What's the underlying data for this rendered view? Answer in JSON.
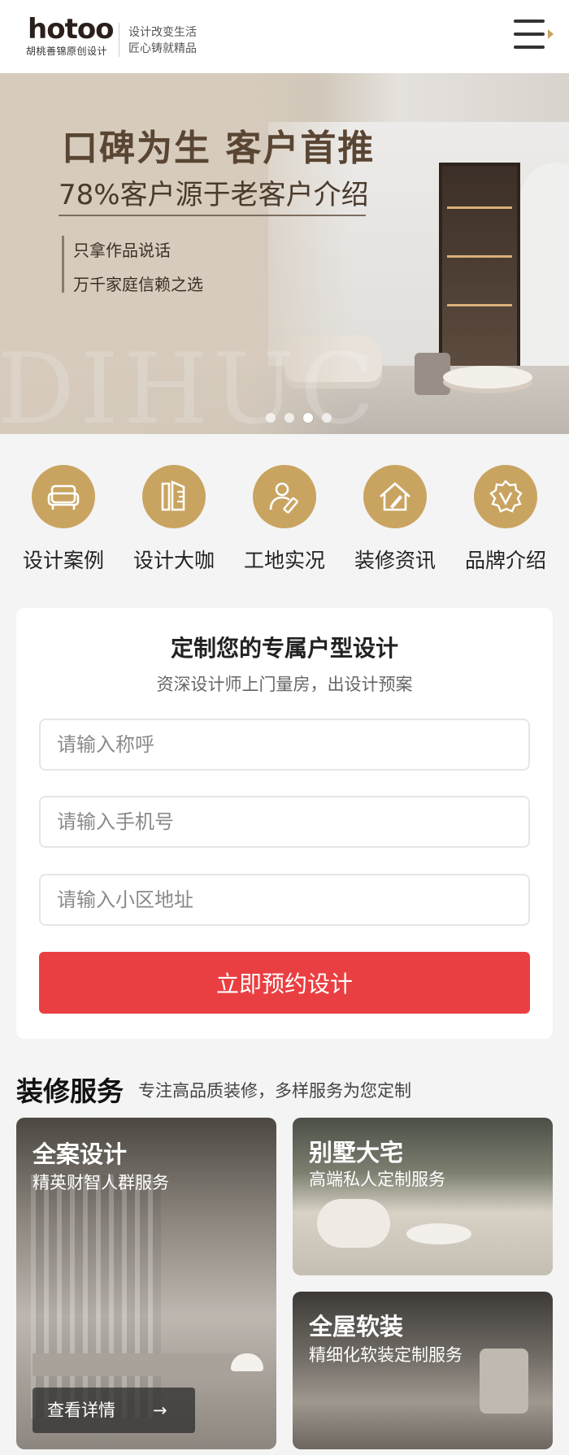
{
  "header": {
    "logo_text": "hotoo",
    "logo_subtitle": "胡桃善锦原创设计",
    "slogan_line1": "设计改变生活",
    "slogan_line2": "匠心铸就精品",
    "menu_icon": "hamburger-menu-icon"
  },
  "banner": {
    "headline": "口碑为生 客户首推",
    "subheadline": "78%客户源于老客户介绍",
    "bullet1": "只拿作品说话",
    "bullet2": "万千家庭信赖之选",
    "background_letters": "DIHUC",
    "slide_count": 4,
    "active_slide": 3
  },
  "categories": [
    {
      "label": "设计案例",
      "icon": "sofa-icon"
    },
    {
      "label": "设计大咖",
      "icon": "ruler-pencil-icon"
    },
    {
      "label": "工地实况",
      "icon": "worker-icon"
    },
    {
      "label": "装修资讯",
      "icon": "house-brush-icon"
    },
    {
      "label": "品牌介绍",
      "icon": "badge-v-icon"
    }
  ],
  "form": {
    "title": "定制您的专属户型设计",
    "subtitle": "资深设计师上门量房，出设计预案",
    "name_placeholder": "请输入称呼",
    "phone_placeholder": "请输入手机号",
    "address_placeholder": "请输入小区地址",
    "submit_label": "立即预约设计"
  },
  "services": {
    "heading": "装修服务",
    "tagline": "专注高品质装修，多样服务为您定制",
    "items": [
      {
        "title": "全案设计",
        "desc": "精英财智人群服务",
        "button": "查看详情",
        "arrow": "→"
      },
      {
        "title": "别墅大宅",
        "desc": "高端私人定制服务"
      },
      {
        "title": "全屋软装",
        "desc": "精细化软装定制服务"
      }
    ]
  },
  "colors": {
    "accent_gold": "#c9a461",
    "cta_red": "#ea3f42",
    "background": "#f4f4f4"
  }
}
